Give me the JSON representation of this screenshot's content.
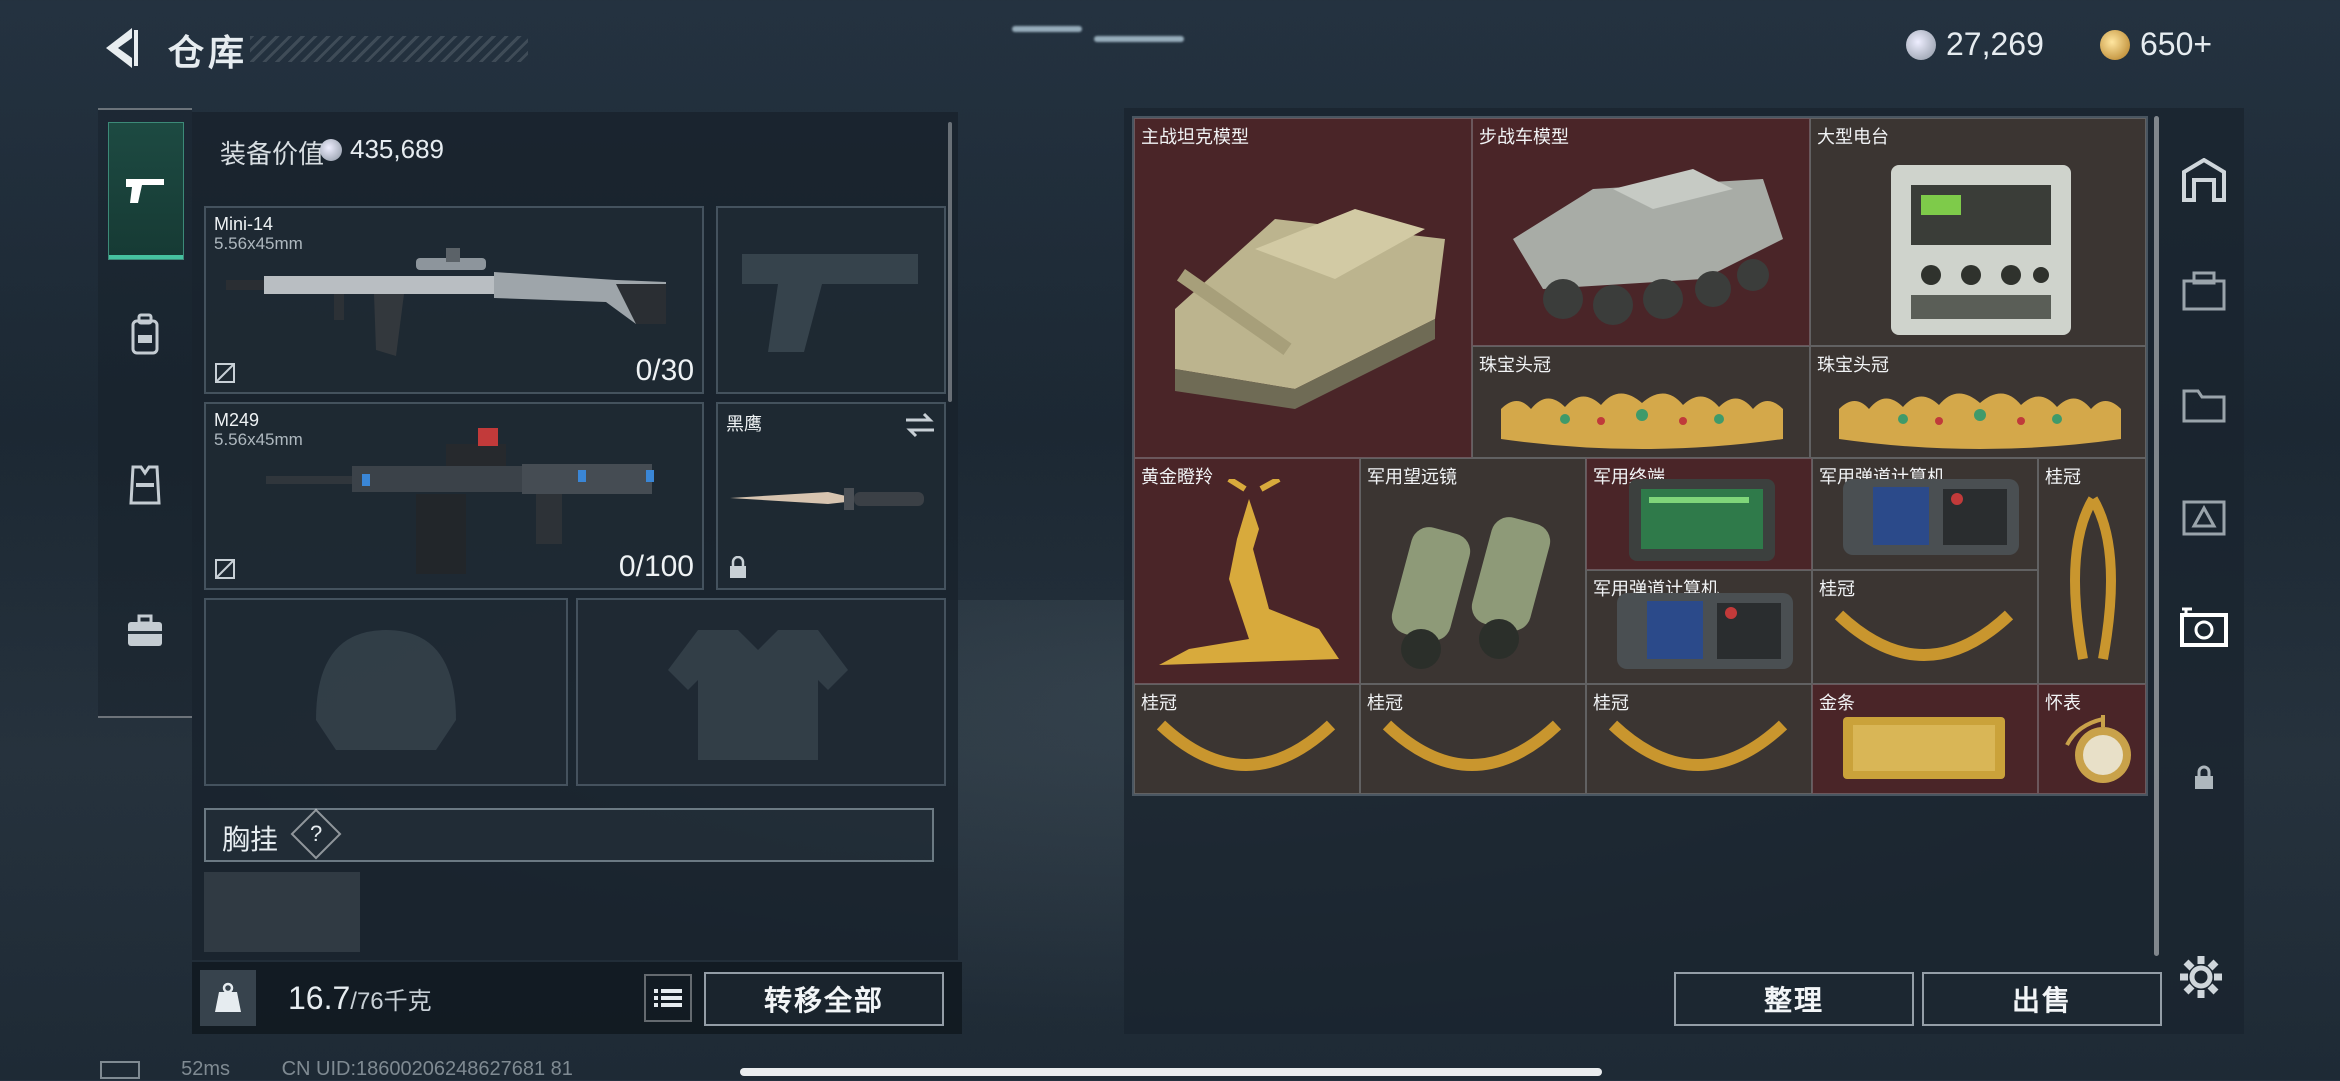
{
  "header": {
    "title": "仓库",
    "currency_primary": "27,269",
    "currency_secondary": "650+"
  },
  "left_nav": {
    "items": [
      "weapons",
      "backpack",
      "vest",
      "case"
    ],
    "active": "weapons"
  },
  "equipment": {
    "value_label": "装备价值",
    "value": "435,689",
    "slots": {
      "primary1": {
        "name": "Mini-14",
        "caliber": "5.56x45mm",
        "ammo": "0/30"
      },
      "primary2": {
        "name": "M249",
        "caliber": "5.56x45mm",
        "ammo": "0/100"
      },
      "knife": {
        "name": "黑鹰"
      }
    },
    "chest_label": "胸挂",
    "chest_help": "?"
  },
  "bottom_left": {
    "weight_current": "16.7",
    "weight_max": "/76千克",
    "transfer_all": "转移全部"
  },
  "container": {
    "items": [
      {
        "label": "主战坦克模型",
        "color": "red"
      },
      {
        "label": "步战车模型",
        "color": "red"
      },
      {
        "label": "大型电台",
        "color": "brown"
      },
      {
        "label": "珠宝头冠",
        "color": "brown"
      },
      {
        "label": "珠宝头冠",
        "color": "brown"
      },
      {
        "label": "黄金瞪羚",
        "color": "red"
      },
      {
        "label": "军用望远镜",
        "color": "brown"
      },
      {
        "label": "军用终端",
        "color": "red"
      },
      {
        "label": "军用弹道计算机",
        "color": "brown"
      },
      {
        "label": "桂冠",
        "color": "brown"
      },
      {
        "label": "军用弹道计算机",
        "color": "brown"
      },
      {
        "label": "桂冠",
        "color": "brown"
      },
      {
        "label": "桂冠",
        "color": "brown"
      },
      {
        "label": "桂冠",
        "color": "brown"
      },
      {
        "label": "桂冠",
        "color": "brown"
      },
      {
        "label": "金条",
        "color": "red"
      },
      {
        "label": "怀表",
        "color": "red"
      }
    ],
    "sort_button": "整理",
    "sell_button": "出售"
  },
  "status_bar": {
    "ping": "52ms",
    "uid": "CN UID:18600206248627681 81"
  }
}
